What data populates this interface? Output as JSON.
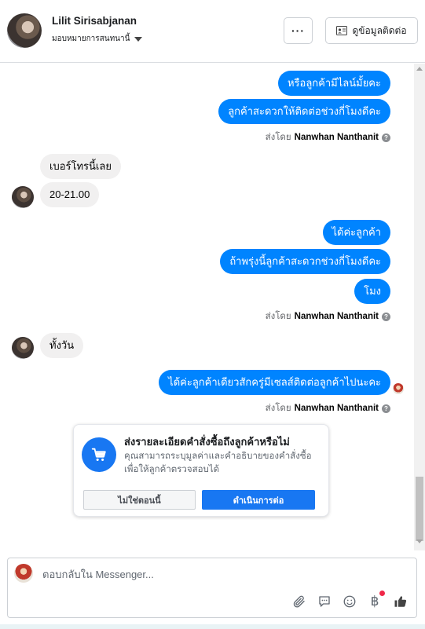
{
  "header": {
    "name": "Lilit Sirisabjanan",
    "subtitle": "มอบหมายการสนทนานี้",
    "more_label": "···",
    "contact_label": "ดูข้อมูลติดต่อ"
  },
  "messages": {
    "out1": "หรือลูกค้ามีไลน์มั้ยคะ",
    "out2": "ลูกค้าสะดวกให้ติดต่อช่วงกี่โมงดีคะ",
    "in1": "เบอร์โทรนี้เลย",
    "in2": "20-21.00",
    "out3": "ได้ค่ะลูกค้า",
    "out4": "ถ้าพรุ่งนี้ลูกค้าสะดวกช่วงกี่โมงดีคะ",
    "out5": "โมง",
    "in3": "ทั้งวัน",
    "out6": "ได้ค่ะลูกค้าเดียวสักครู่มีเซลส์ติดต่อลูกค้าไปนะคะ"
  },
  "sent_by": {
    "prefix": "ส่งโดย",
    "name": "Nanwhan Nanthanit",
    "help": "?"
  },
  "card": {
    "title": "ส่งรายละเอียดคำสั่งซื้อถึงลูกค้าหรือไม่",
    "description": "คุณสามารถระบุมูลค่าและคำอธิบายของคำสั่งซื้อเพื่อให้ลูกค้าตรวจสอบได้",
    "secondary_button": "ไม่ใช่ตอนนี้",
    "primary_button": "ดำเนินการต่อ"
  },
  "composer": {
    "placeholder": "ตอบกลับใน Messenger...",
    "currency_symbol": "฿"
  },
  "colors": {
    "outgoing_bubble": "#0084ff",
    "incoming_bubble": "#f1f0f0",
    "primary": "#1877f2"
  },
  "icons": [
    "more-icon",
    "contact-card-icon",
    "cart-icon",
    "attachment-icon",
    "chat-icon",
    "emoji-icon",
    "baht-icon",
    "thumbs-up-icon",
    "help-icon"
  ]
}
